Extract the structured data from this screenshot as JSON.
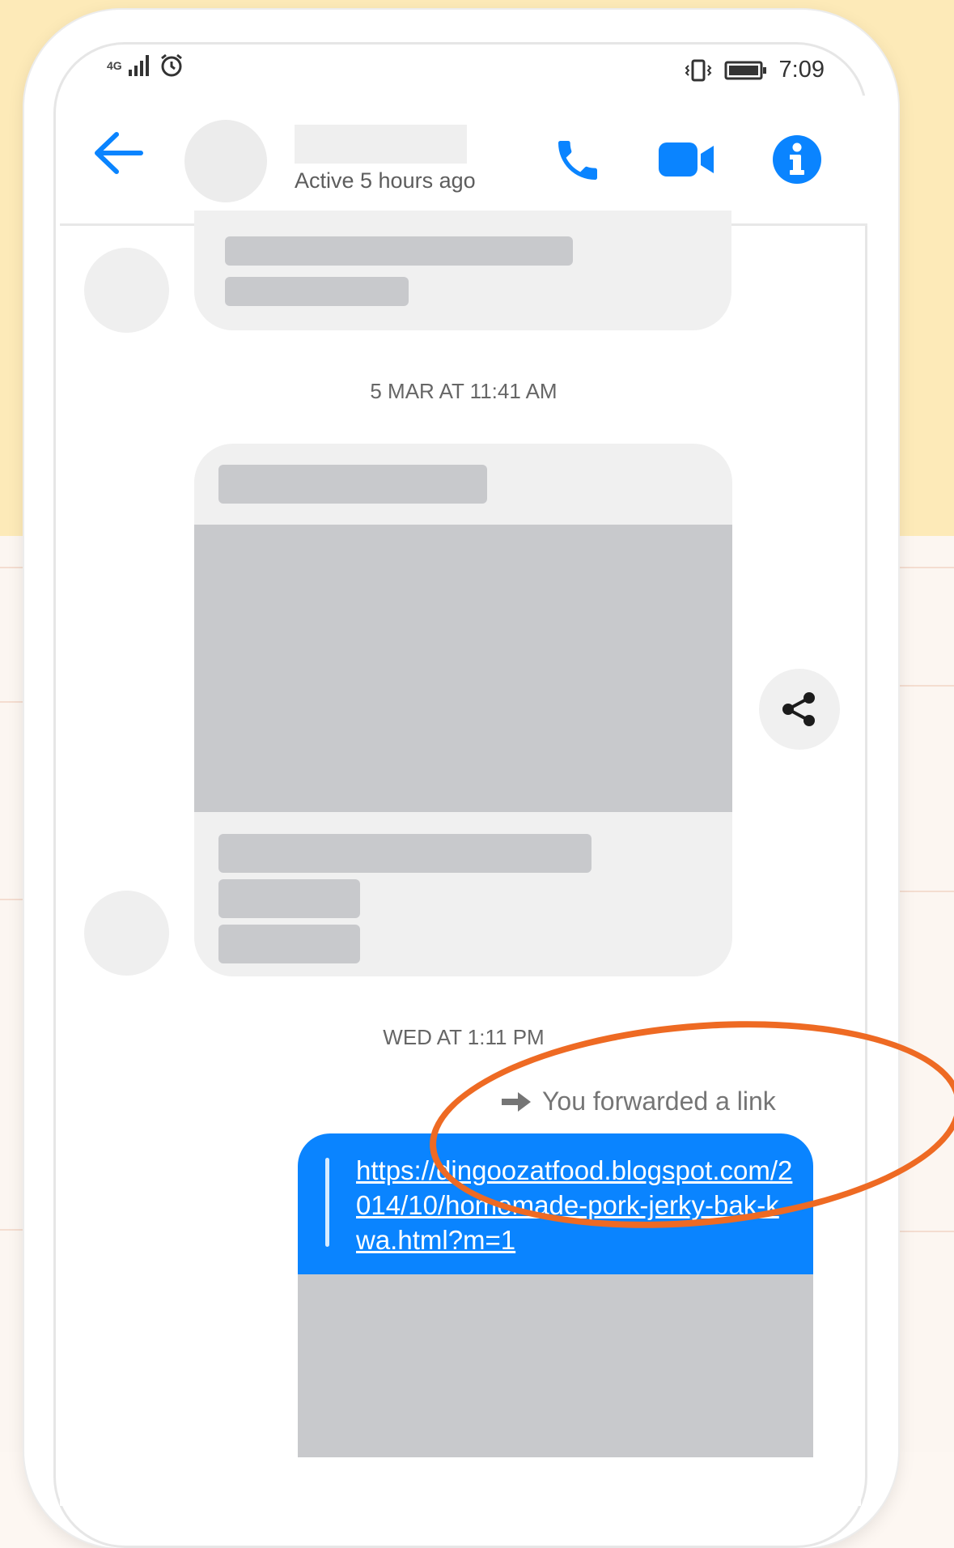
{
  "status_bar": {
    "network": "4G",
    "time": "7:09"
  },
  "header": {
    "active_status": "Active 5 hours ago"
  },
  "messages": {
    "timestamp_1": "5 MAR AT 11:41 AM",
    "timestamp_2": "WED AT 1:11 PM",
    "forward_note": "You forwarded a link",
    "link": "https://dingoozatfood.blogspot.com/2014/10/homemade-pork-jerky-bak-kwa.html?m=1"
  },
  "colors": {
    "accent": "#0a84ff",
    "annotation": "#ee6a23"
  }
}
